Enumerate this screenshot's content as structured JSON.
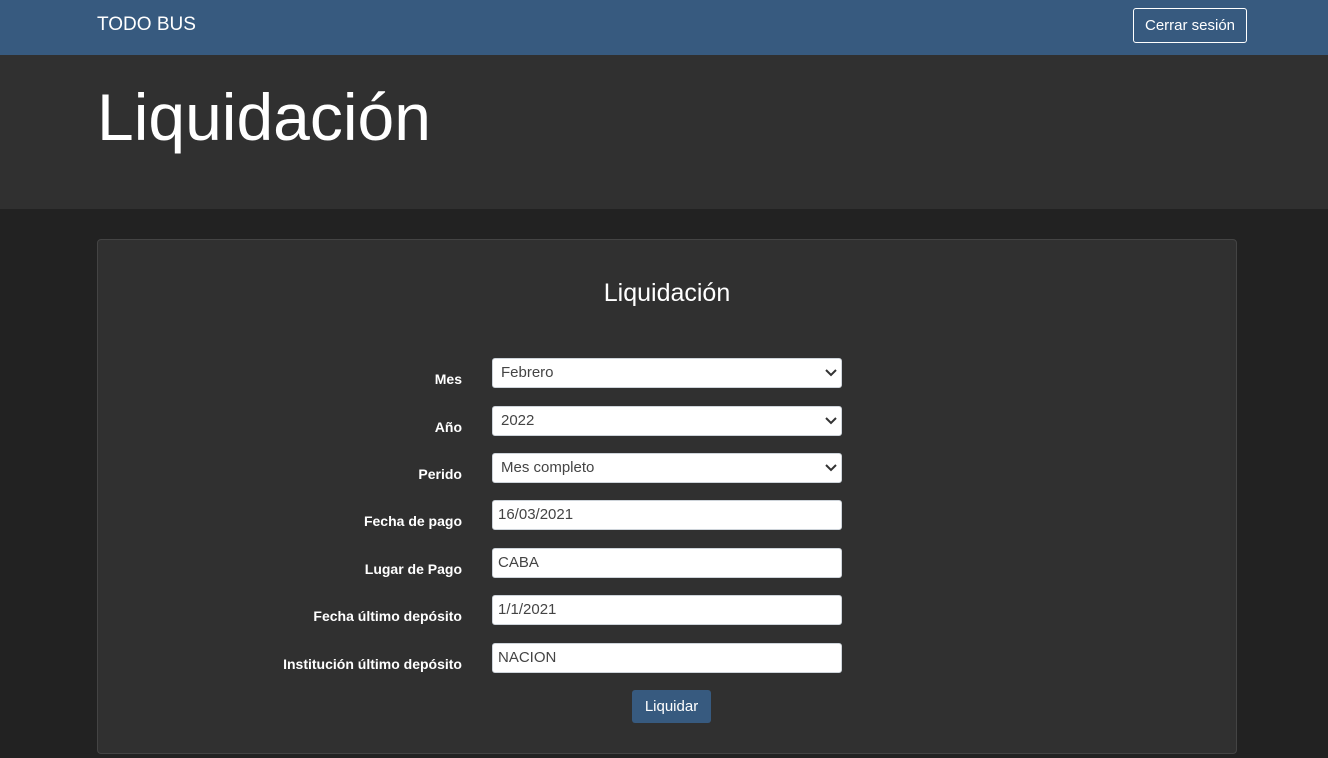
{
  "navbar": {
    "brand": "TODO BUS",
    "logout_label": "Cerrar sesión"
  },
  "header": {
    "title": "Liquidación"
  },
  "form": {
    "title": "Liquidación",
    "fields": {
      "mes": {
        "label": "Mes",
        "value": "Febrero"
      },
      "anio": {
        "label": "Año",
        "value": "2022"
      },
      "periodo": {
        "label": "Perido",
        "value": "Mes completo"
      },
      "fecha_pago": {
        "label": "Fecha de pago",
        "value": "16/03/2021"
      },
      "lugar_pago": {
        "label": "Lugar de Pago",
        "value": "CABA"
      },
      "fecha_ultimo_deposito": {
        "label": "Fecha último depósito",
        "value": "1/1/2021"
      },
      "institucion_ultimo_deposito": {
        "label": "Institución último depósito",
        "value": "NACION"
      }
    },
    "submit_label": "Liquidar"
  },
  "colors": {
    "primary": "#375a7f",
    "background": "#222222",
    "surface": "#303030"
  }
}
